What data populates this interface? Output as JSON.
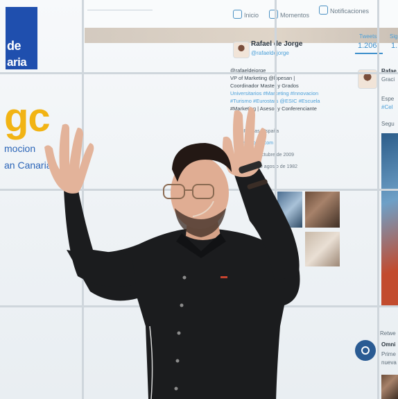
{
  "screen": {
    "brand_line1": "de",
    "brand_line2": "aria",
    "gc_text": "gc",
    "promo_text": "mocion",
    "canaria_text": "an Canaria",
    "nav": {
      "home": "Inicio",
      "moments": "Momentos",
      "notifications": "Notificaciones"
    },
    "profile": {
      "name": "Rafael de Jorge",
      "handle": "@rafaeldejorge",
      "stats": [
        {
          "label": "Tweets",
          "value": "1.206"
        },
        {
          "label": "Sig",
          "value": "1."
        }
      ],
      "bio_lines": [
        "@rafaeldejorge",
        "VP of Marketing @lopesan |",
        "Coordinador Master y Grados",
        "Universitarios #Marketing #Innovacion",
        "#Turismo #Eurostars @ESIC #Escuela",
        "#Marketing | Asesor y Conferenciante"
      ],
      "meta_lines": [
        "Las Palmas, España",
        "rafaeldejorge.com",
        "Se unió en octubre de 2009",
        "Nació el 1 de agosto de 1982"
      ]
    },
    "right_column": {
      "name_partial": "Rafae",
      "text1": "Graci",
      "text2": "Espe",
      "text3": "#Cel",
      "text4": "Segu",
      "omni_name": "Omni",
      "omni_text1": "Prime",
      "omni_text2": "nueva",
      "retweet_label": "Retwe"
    }
  }
}
